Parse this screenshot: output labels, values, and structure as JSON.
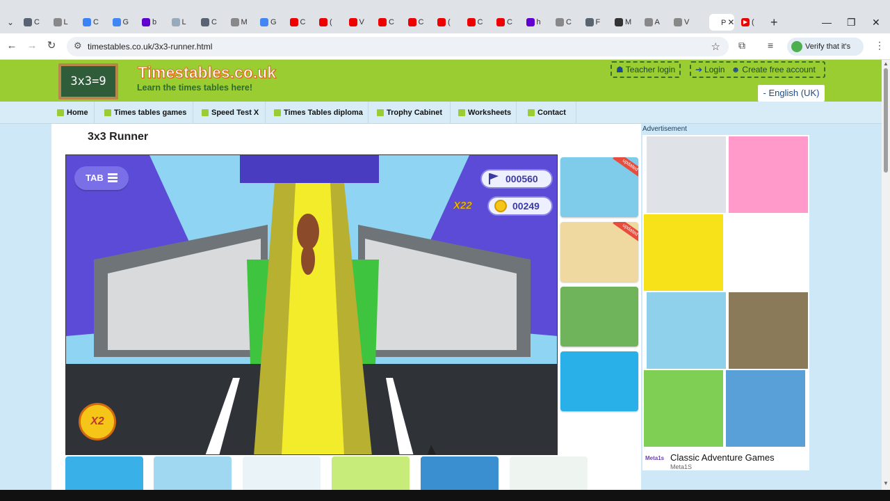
{
  "browser": {
    "tabs": [
      {
        "label": "C",
        "color": "#5a6470"
      },
      {
        "label": "L",
        "color": "#888"
      },
      {
        "label": "C",
        "color": "#3b82f6"
      },
      {
        "label": "G",
        "color": "#4285f4"
      },
      {
        "label": "b",
        "color": "#6001d2"
      },
      {
        "label": "L",
        "color": "#9ab"
      },
      {
        "label": "C",
        "color": "#5a6470"
      },
      {
        "label": "M",
        "color": "#888"
      },
      {
        "label": "G",
        "color": "#4285f4"
      },
      {
        "label": "C",
        "color": "#e00"
      },
      {
        "label": "(",
        "color": "#e00"
      },
      {
        "label": "V",
        "color": "#e00"
      },
      {
        "label": "C",
        "color": "#e00"
      },
      {
        "label": "C",
        "color": "#e00"
      },
      {
        "label": "(",
        "color": "#e00"
      },
      {
        "label": "C",
        "color": "#e00"
      },
      {
        "label": "C",
        "color": "#e00"
      },
      {
        "label": "h",
        "color": "#6001d2"
      },
      {
        "label": "C",
        "color": "#888"
      },
      {
        "label": "F",
        "color": "#5a6470"
      },
      {
        "label": "M",
        "color": "#333"
      },
      {
        "label": "A",
        "color": "#888"
      },
      {
        "label": "V",
        "color": "#888"
      }
    ],
    "active_tab": {
      "label": "P"
    },
    "last_tab": {
      "label": "(",
      "color": "#e00"
    },
    "url": "timestables.co.uk/3x3-runner.html",
    "profile_label": "Verify that it's you"
  },
  "site": {
    "logo_text": "3x3=9",
    "title": "Timestables.co.uk",
    "tagline": "Learn the times tables here!",
    "teacher_login": "Teacher login",
    "login": "Login",
    "create_account": "Create free account",
    "language": "- English (UK)"
  },
  "nav": {
    "items": [
      "Home",
      "Times tables games",
      "Speed Test X",
      "Times Tables diploma",
      "Trophy Cabinet",
      "Worksheets",
      "Contact"
    ]
  },
  "game": {
    "title": "3x3 Runner",
    "tab_label": "TAB",
    "distance": "000560",
    "coins": "00249",
    "multiplier": "X22",
    "badge": "X2"
  },
  "side_games": [
    {
      "badge": "updated",
      "bg": "#7ecbea"
    },
    {
      "badge": "updated",
      "bg": "#f0d9a0"
    },
    {
      "badge": "",
      "bg": "#6fb35a"
    },
    {
      "badge": "",
      "bg": "#2ab0e8"
    }
  ],
  "ad": {
    "label": "Advertisement",
    "caption": "Classic Adventure Games",
    "brand": "Meta1S",
    "logo": "Meta1s"
  }
}
